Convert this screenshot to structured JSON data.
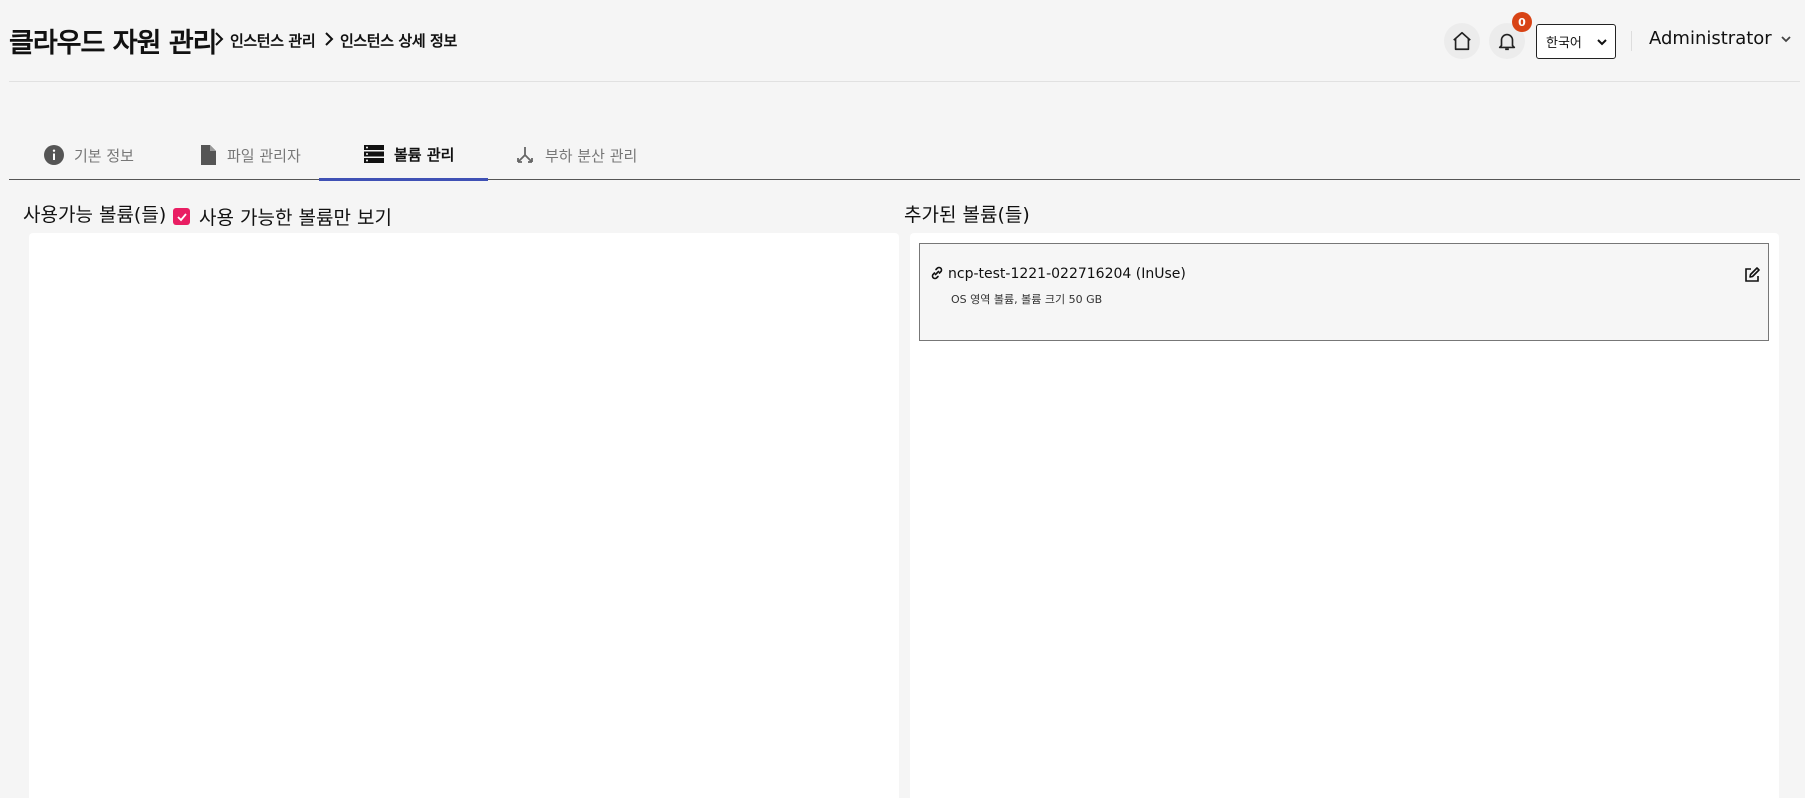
{
  "header": {
    "app_title": "클라우드 자원 관리",
    "breadcrumbs": [
      "인스턴스 관리",
      "인스턴스 상세 정보"
    ],
    "notification_count": "0",
    "language": "한국어",
    "user": "Administrator"
  },
  "tabs": [
    {
      "label": "기본 정보",
      "icon": "info-icon"
    },
    {
      "label": "파일 관리자",
      "icon": "file-icon"
    },
    {
      "label": "볼륨 관리",
      "icon": "storage-icon",
      "active": true
    },
    {
      "label": "부하 분산 관리",
      "icon": "load-balance-icon"
    }
  ],
  "available": {
    "title": "사용가능 볼륨(들)",
    "filter_label": "사용 가능한 볼륨만 보기",
    "filter_checked": true
  },
  "added": {
    "title": "추가된 볼륨(들)",
    "volumes": [
      {
        "name": "ncp-test-1221-022716204 (InUse)",
        "desc": "OS 영역 볼륨, 볼륨 크기 50 GB"
      }
    ]
  },
  "colors": {
    "accent": "#3f51b5",
    "checkbox": "#e91e63",
    "badge": "#d84315"
  }
}
